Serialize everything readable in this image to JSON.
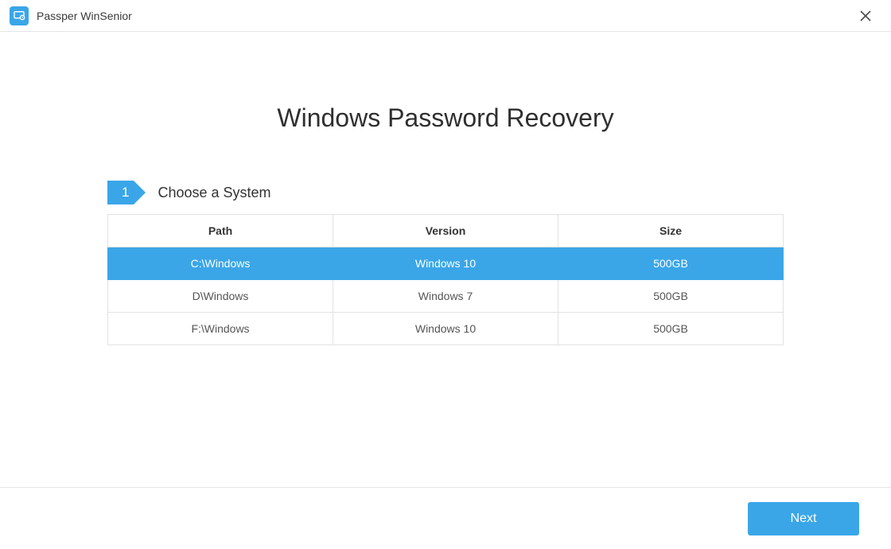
{
  "header": {
    "app_title": "Passper WinSenior"
  },
  "main": {
    "title": "Windows Password Recovery",
    "step": {
      "number": "1",
      "label": "Choose a System"
    },
    "table": {
      "columns": [
        "Path",
        "Version",
        "Size"
      ],
      "rows": [
        {
          "path": "C:\\Windows",
          "version": "Windows 10",
          "size": "500GB",
          "selected": true
        },
        {
          "path": "D\\Windows",
          "version": "Windows 7",
          "size": "500GB",
          "selected": false
        },
        {
          "path": "F:\\Windows",
          "version": "Windows 10",
          "size": "500GB",
          "selected": false
        }
      ]
    }
  },
  "footer": {
    "next_label": "Next"
  },
  "colors": {
    "accent": "#3aa6e8",
    "border": "#e2e2e2"
  }
}
